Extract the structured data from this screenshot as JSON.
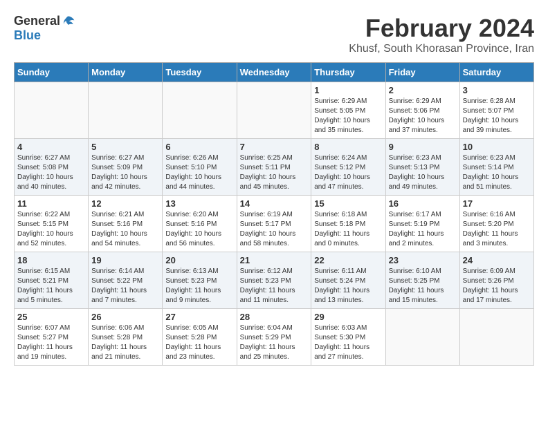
{
  "header": {
    "logo_general": "General",
    "logo_blue": "Blue",
    "month_year": "February 2024",
    "location": "Khusf, South Khorasan Province, Iran"
  },
  "weekdays": [
    "Sunday",
    "Monday",
    "Tuesday",
    "Wednesday",
    "Thursday",
    "Friday",
    "Saturday"
  ],
  "weeks": [
    [
      {
        "day": "",
        "info": ""
      },
      {
        "day": "",
        "info": ""
      },
      {
        "day": "",
        "info": ""
      },
      {
        "day": "",
        "info": ""
      },
      {
        "day": "1",
        "info": "Sunrise: 6:29 AM\nSunset: 5:05 PM\nDaylight: 10 hours\nand 35 minutes."
      },
      {
        "day": "2",
        "info": "Sunrise: 6:29 AM\nSunset: 5:06 PM\nDaylight: 10 hours\nand 37 minutes."
      },
      {
        "day": "3",
        "info": "Sunrise: 6:28 AM\nSunset: 5:07 PM\nDaylight: 10 hours\nand 39 minutes."
      }
    ],
    [
      {
        "day": "4",
        "info": "Sunrise: 6:27 AM\nSunset: 5:08 PM\nDaylight: 10 hours\nand 40 minutes."
      },
      {
        "day": "5",
        "info": "Sunrise: 6:27 AM\nSunset: 5:09 PM\nDaylight: 10 hours\nand 42 minutes."
      },
      {
        "day": "6",
        "info": "Sunrise: 6:26 AM\nSunset: 5:10 PM\nDaylight: 10 hours\nand 44 minutes."
      },
      {
        "day": "7",
        "info": "Sunrise: 6:25 AM\nSunset: 5:11 PM\nDaylight: 10 hours\nand 45 minutes."
      },
      {
        "day": "8",
        "info": "Sunrise: 6:24 AM\nSunset: 5:12 PM\nDaylight: 10 hours\nand 47 minutes."
      },
      {
        "day": "9",
        "info": "Sunrise: 6:23 AM\nSunset: 5:13 PM\nDaylight: 10 hours\nand 49 minutes."
      },
      {
        "day": "10",
        "info": "Sunrise: 6:23 AM\nSunset: 5:14 PM\nDaylight: 10 hours\nand 51 minutes."
      }
    ],
    [
      {
        "day": "11",
        "info": "Sunrise: 6:22 AM\nSunset: 5:15 PM\nDaylight: 10 hours\nand 52 minutes."
      },
      {
        "day": "12",
        "info": "Sunrise: 6:21 AM\nSunset: 5:16 PM\nDaylight: 10 hours\nand 54 minutes."
      },
      {
        "day": "13",
        "info": "Sunrise: 6:20 AM\nSunset: 5:16 PM\nDaylight: 10 hours\nand 56 minutes."
      },
      {
        "day": "14",
        "info": "Sunrise: 6:19 AM\nSunset: 5:17 PM\nDaylight: 10 hours\nand 58 minutes."
      },
      {
        "day": "15",
        "info": "Sunrise: 6:18 AM\nSunset: 5:18 PM\nDaylight: 11 hours\nand 0 minutes."
      },
      {
        "day": "16",
        "info": "Sunrise: 6:17 AM\nSunset: 5:19 PM\nDaylight: 11 hours\nand 2 minutes."
      },
      {
        "day": "17",
        "info": "Sunrise: 6:16 AM\nSunset: 5:20 PM\nDaylight: 11 hours\nand 3 minutes."
      }
    ],
    [
      {
        "day": "18",
        "info": "Sunrise: 6:15 AM\nSunset: 5:21 PM\nDaylight: 11 hours\nand 5 minutes."
      },
      {
        "day": "19",
        "info": "Sunrise: 6:14 AM\nSunset: 5:22 PM\nDaylight: 11 hours\nand 7 minutes."
      },
      {
        "day": "20",
        "info": "Sunrise: 6:13 AM\nSunset: 5:23 PM\nDaylight: 11 hours\nand 9 minutes."
      },
      {
        "day": "21",
        "info": "Sunrise: 6:12 AM\nSunset: 5:23 PM\nDaylight: 11 hours\nand 11 minutes."
      },
      {
        "day": "22",
        "info": "Sunrise: 6:11 AM\nSunset: 5:24 PM\nDaylight: 11 hours\nand 13 minutes."
      },
      {
        "day": "23",
        "info": "Sunrise: 6:10 AM\nSunset: 5:25 PM\nDaylight: 11 hours\nand 15 minutes."
      },
      {
        "day": "24",
        "info": "Sunrise: 6:09 AM\nSunset: 5:26 PM\nDaylight: 11 hours\nand 17 minutes."
      }
    ],
    [
      {
        "day": "25",
        "info": "Sunrise: 6:07 AM\nSunset: 5:27 PM\nDaylight: 11 hours\nand 19 minutes."
      },
      {
        "day": "26",
        "info": "Sunrise: 6:06 AM\nSunset: 5:28 PM\nDaylight: 11 hours\nand 21 minutes."
      },
      {
        "day": "27",
        "info": "Sunrise: 6:05 AM\nSunset: 5:28 PM\nDaylight: 11 hours\nand 23 minutes."
      },
      {
        "day": "28",
        "info": "Sunrise: 6:04 AM\nSunset: 5:29 PM\nDaylight: 11 hours\nand 25 minutes."
      },
      {
        "day": "29",
        "info": "Sunrise: 6:03 AM\nSunset: 5:30 PM\nDaylight: 11 hours\nand 27 minutes."
      },
      {
        "day": "",
        "info": ""
      },
      {
        "day": "",
        "info": ""
      }
    ]
  ]
}
